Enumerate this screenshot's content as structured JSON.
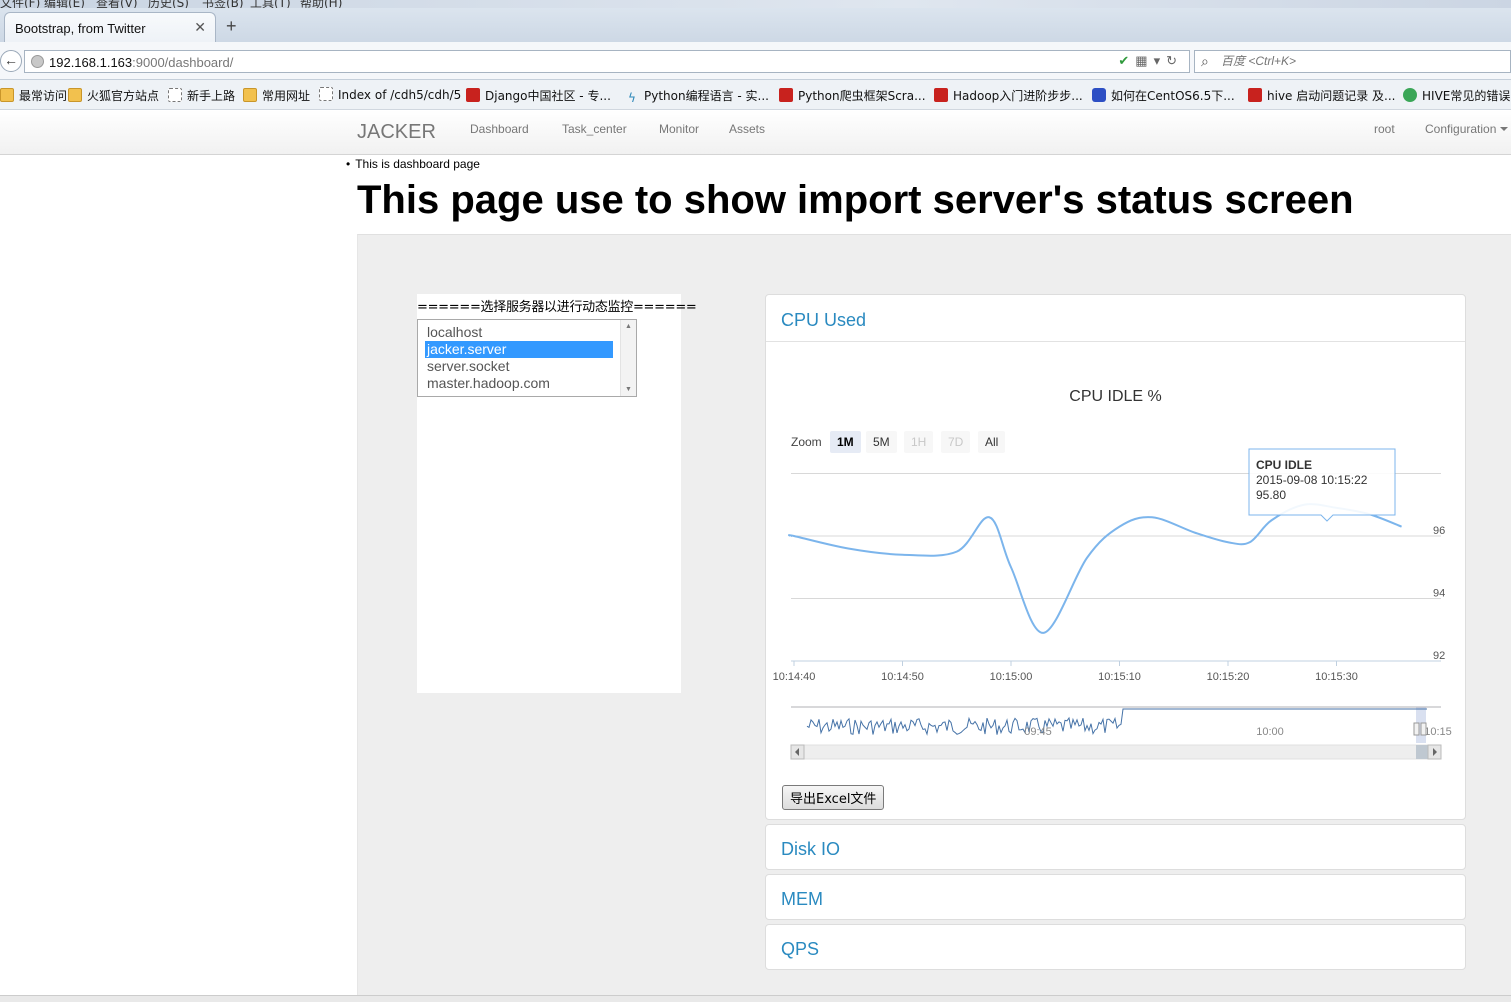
{
  "browser": {
    "menu": [
      "文件(F)",
      "编辑(E)",
      "查看(V)",
      "历史(S)",
      "书签(B)",
      "工具(T)",
      "帮助(H)"
    ],
    "tab_title": "Bootstrap, from Twitter",
    "url_host": "192.168.1.163",
    "url_rest": ":9000/dashboard/",
    "search_placeholder": "百度 <Ctrl+K>",
    "bookmarks": [
      {
        "label": "最常访问",
        "icon": "folder"
      },
      {
        "label": "火狐官方站点",
        "icon": "folder"
      },
      {
        "label": "新手上路",
        "icon": "page"
      },
      {
        "label": "常用网址",
        "icon": "folder"
      },
      {
        "label": "Index of /cdh5/cdh/5",
        "icon": "page"
      },
      {
        "label": "Django中国社区 - 专...",
        "icon": "red"
      },
      {
        "label": "Python编程语言 - 实...",
        "icon": "teal"
      },
      {
        "label": "Python爬虫框架Scra...",
        "icon": "red"
      },
      {
        "label": "Hadoop入门进阶步步...",
        "icon": "red"
      },
      {
        "label": "如何在CentOS6.5下...",
        "icon": "paw"
      },
      {
        "label": "hive 启动问题记录 及...",
        "icon": "red"
      },
      {
        "label": "HIVE常见的错误",
        "icon": "green"
      }
    ]
  },
  "nav": {
    "brand": "JACKER",
    "links": [
      "Dashboard",
      "Task_center",
      "Monitor",
      "Assets"
    ],
    "user": "root",
    "configuration": "Configuration"
  },
  "page": {
    "subtitle": "This is dashboard page",
    "heading": "This page use to show import server's status screen"
  },
  "server_selector": {
    "label": "======选择服务器以进行动态监控======",
    "options": [
      "localhost",
      "jacker.server",
      "server.socket",
      "master.hadoop.com"
    ],
    "selected": "jacker.server"
  },
  "panels": {
    "cpu": "CPU Used",
    "disk": "Disk IO",
    "mem": "MEM",
    "qps": "QPS"
  },
  "chart": {
    "zoom_label": "Zoom",
    "zoom_buttons": [
      {
        "label": "1M",
        "state": "active"
      },
      {
        "label": "5M",
        "state": "normal"
      },
      {
        "label": "1H",
        "state": "disabled"
      },
      {
        "label": "7D",
        "state": "disabled"
      },
      {
        "label": "All",
        "state": "normal"
      }
    ],
    "export_label": "导出Excel文件",
    "tooltip": {
      "title": "CPU IDLE",
      "time": "2015-09-08 10:15:22",
      "value": "95.80"
    },
    "navigator_ticks": [
      "09:45",
      "10:00",
      "10:15"
    ],
    "series_color": "#7cb5ec"
  },
  "chart_data": {
    "type": "line",
    "title": "CPU IDLE %",
    "x_tick_labels": [
      "10:14:40",
      "10:14:50",
      "10:15:00",
      "10:15:10",
      "10:15:20",
      "10:15:30"
    ],
    "y_tick_labels": [
      "92",
      "94",
      "96"
    ],
    "ylim": [
      92,
      98.4
    ],
    "x": [
      "10:14:40",
      "10:14:45",
      "10:14:50",
      "10:14:55",
      "10:14:58",
      "10:15:00",
      "10:15:03",
      "10:15:07",
      "10:15:10",
      "10:15:13",
      "10:15:17",
      "10:15:20",
      "10:15:22",
      "10:15:24",
      "10:15:27",
      "10:15:30",
      "10:15:33",
      "10:15:36"
    ],
    "values": [
      96.0,
      95.6,
      95.4,
      95.5,
      96.6,
      95.0,
      92.9,
      95.3,
      96.3,
      96.6,
      96.1,
      95.8,
      95.8,
      96.5,
      97.0,
      96.9,
      96.7,
      96.3
    ],
    "grid": true,
    "series": [
      {
        "values": [
          96.0,
          95.6,
          95.4,
          95.5,
          96.6,
          95.0,
          92.9,
          95.3,
          96.3,
          96.6,
          96.1,
          95.8,
          95.8,
          96.5,
          97.0,
          96.9,
          96.7,
          96.3
        ]
      }
    ]
  }
}
